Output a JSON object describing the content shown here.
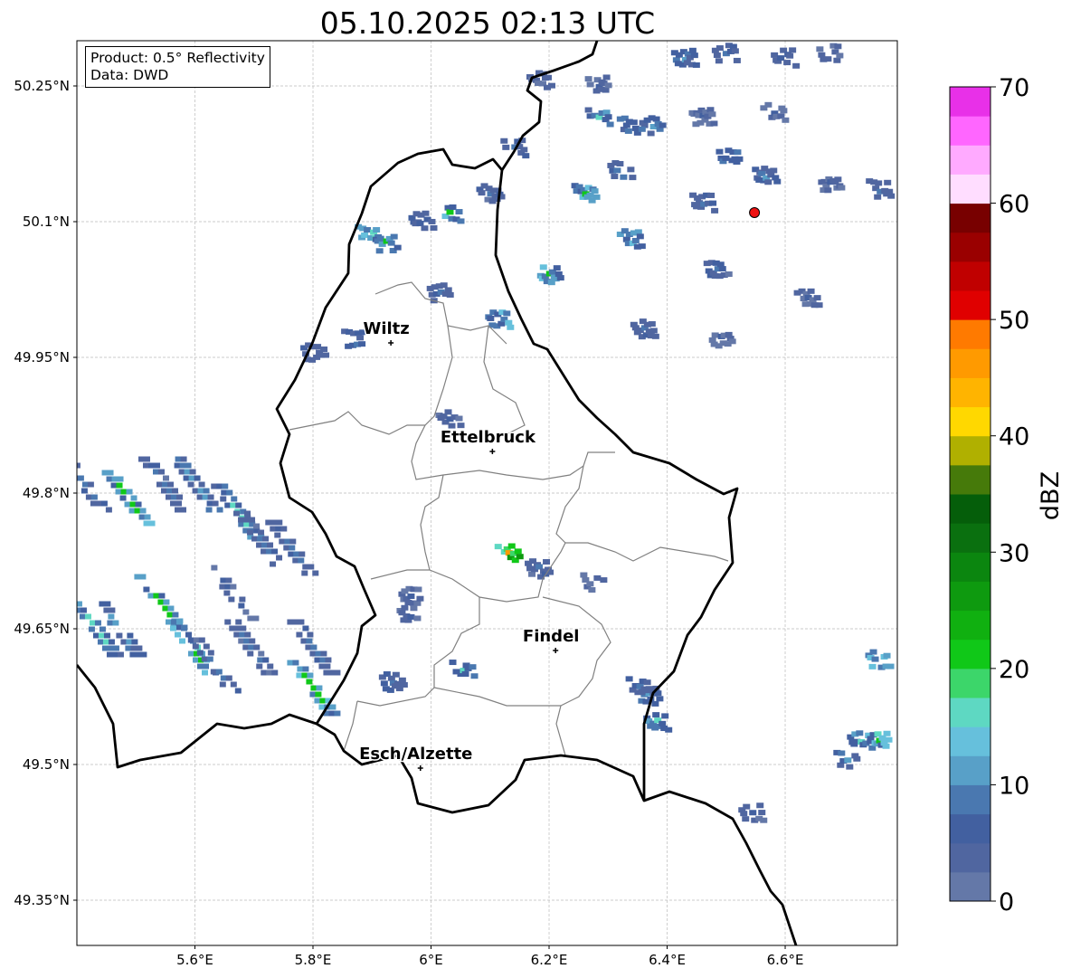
{
  "title": "05.10.2025 02:13 UTC",
  "info_box": {
    "product": "Product: 0.5° Reflectivity",
    "data": "Data: DWD"
  },
  "map": {
    "lon_range": [
      5.4,
      6.79
    ],
    "lat_range": [
      49.3,
      50.3
    ],
    "x_ticks": [
      {
        "value": 5.6,
        "label": "5.6°E"
      },
      {
        "value": 5.8,
        "label": "5.8°E"
      },
      {
        "value": 6.0,
        "label": "6°E"
      },
      {
        "value": 6.2,
        "label": "6.2°E"
      },
      {
        "value": 6.4,
        "label": "6.4°E"
      },
      {
        "value": 6.6,
        "label": "6.6°E"
      }
    ],
    "y_ticks": [
      {
        "value": 50.25,
        "label": "50.25°N"
      },
      {
        "value": 50.1,
        "label": "50.1°N"
      },
      {
        "value": 49.95,
        "label": "49.95°N"
      },
      {
        "value": 49.8,
        "label": "49.8°N"
      },
      {
        "value": 49.65,
        "label": "49.65°N"
      },
      {
        "value": 49.5,
        "label": "49.5°N"
      },
      {
        "value": 49.35,
        "label": "49.35°N"
      }
    ],
    "cities": [
      {
        "name": "Wiltz",
        "lon": 5.932,
        "lat": 49.966
      },
      {
        "name": "Ettelbruck",
        "lon": 6.104,
        "lat": 49.846
      },
      {
        "name": "Findel",
        "lon": 6.211,
        "lat": 49.626
      },
      {
        "name": "Esch/Alzette",
        "lon": 5.982,
        "lat": 49.496
      }
    ],
    "radar_site": {
      "lon": 6.548,
      "lat": 50.11,
      "color": "#ee1111"
    }
  },
  "colorbar": {
    "label": "dBZ",
    "min": 0,
    "max": 70,
    "ticks": [
      "0",
      "10",
      "20",
      "30",
      "40",
      "50",
      "60",
      "70"
    ],
    "colors": [
      "#6478a8",
      "#5066a0",
      "#4260a0",
      "#4a78b0",
      "#58a0c8",
      "#66c0dc",
      "#5ed8c2",
      "#3cd66a",
      "#10c818",
      "#10b010",
      "#0e9a0f",
      "#0b860f",
      "#0a700f",
      "#055e0a",
      "#467a0a",
      "#b0b000",
      "#ffd800",
      "#ffb400",
      "#ff9a00",
      "#ff7a00",
      "#e00000",
      "#c00000",
      "#9a0000",
      "#780000",
      "#ffddff",
      "#ffaaff",
      "#ff66ff",
      "#e830e8"
    ]
  },
  "echoes": [
    {
      "lon": 5.899,
      "lat": 50.086,
      "dbz": 22
    },
    {
      "lon": 5.929,
      "lat": 50.076,
      "dbz": 20
    },
    {
      "lon": 5.99,
      "lat": 50.101,
      "dbz": 8
    },
    {
      "lon": 6.036,
      "lat": 50.108,
      "dbz": 20
    },
    {
      "lon": 6.105,
      "lat": 50.131,
      "dbz": 8
    },
    {
      "lon": 6.021,
      "lat": 50.021,
      "dbz": 8
    },
    {
      "lon": 6.12,
      "lat": 49.991,
      "dbz": 20
    },
    {
      "lon": 5.876,
      "lat": 49.971,
      "dbz": 12
    },
    {
      "lon": 5.807,
      "lat": 49.956,
      "dbz": 8
    },
    {
      "lon": 6.036,
      "lat": 49.881,
      "dbz": 5
    },
    {
      "lon": 6.136,
      "lat": 49.734,
      "dbz": 45
    },
    {
      "lon": 6.187,
      "lat": 49.716,
      "dbz": 8
    },
    {
      "lon": 6.281,
      "lat": 49.701,
      "dbz": 5
    },
    {
      "lon": 5.97,
      "lat": 49.686,
      "dbz": 5
    },
    {
      "lon": 5.97,
      "lat": 49.666,
      "dbz": 5
    },
    {
      "lon": 6.059,
      "lat": 49.606,
      "dbz": 15
    },
    {
      "lon": 5.94,
      "lat": 49.591,
      "dbz": 8
    },
    {
      "lon": 5.419,
      "lat": 49.806,
      "dbz": 8
    },
    {
      "lon": 5.492,
      "lat": 49.791,
      "dbz": 20
    },
    {
      "lon": 5.554,
      "lat": 49.806,
      "dbz": 8
    },
    {
      "lon": 5.607,
      "lat": 49.806,
      "dbz": 12
    },
    {
      "lon": 5.677,
      "lat": 49.776,
      "dbz": 15
    },
    {
      "lon": 5.715,
      "lat": 49.746,
      "dbz": 8
    },
    {
      "lon": 5.769,
      "lat": 49.736,
      "dbz": 8
    },
    {
      "lon": 5.439,
      "lat": 49.646,
      "dbz": 15
    },
    {
      "lon": 5.478,
      "lat": 49.646,
      "dbz": 12
    },
    {
      "lon": 5.547,
      "lat": 49.676,
      "dbz": 20
    },
    {
      "lon": 5.6,
      "lat": 49.626,
      "dbz": 22
    },
    {
      "lon": 5.638,
      "lat": 49.606,
      "dbz": 8
    },
    {
      "lon": 5.668,
      "lat": 49.686,
      "dbz": 5
    },
    {
      "lon": 5.7,
      "lat": 49.626,
      "dbz": 8
    },
    {
      "lon": 5.806,
      "lat": 49.581,
      "dbz": 22
    },
    {
      "lon": 5.806,
      "lat": 49.626,
      "dbz": 8
    },
    {
      "lon": 6.373,
      "lat": 49.576,
      "dbz": 12
    },
    {
      "lon": 6.388,
      "lat": 49.546,
      "dbz": 15
    },
    {
      "lon": 6.358,
      "lat": 49.586,
      "dbz": 8
    },
    {
      "lon": 6.549,
      "lat": 49.446,
      "dbz": 5
    },
    {
      "lon": 6.733,
      "lat": 49.526,
      "dbz": 15
    },
    {
      "lon": 6.764,
      "lat": 49.526,
      "dbz": 22
    },
    {
      "lon": 6.764,
      "lat": 49.616,
      "dbz": 22
    },
    {
      "lon": 6.71,
      "lat": 49.506,
      "dbz": 12
    },
    {
      "lon": 6.205,
      "lat": 50.041,
      "dbz": 20
    },
    {
      "lon": 6.343,
      "lat": 50.081,
      "dbz": 20
    },
    {
      "lon": 6.266,
      "lat": 50.131,
      "dbz": 20
    },
    {
      "lon": 6.327,
      "lat": 50.156,
      "dbz": 12
    },
    {
      "lon": 6.381,
      "lat": 50.206,
      "dbz": 12
    },
    {
      "lon": 6.289,
      "lat": 50.216,
      "dbz": 15
    },
    {
      "lon": 6.343,
      "lat": 50.206,
      "dbz": 15
    },
    {
      "lon": 6.435,
      "lat": 50.281,
      "dbz": 12
    },
    {
      "lon": 6.504,
      "lat": 50.286,
      "dbz": 8
    },
    {
      "lon": 6.604,
      "lat": 50.281,
      "dbz": 8
    },
    {
      "lon": 6.681,
      "lat": 50.286,
      "dbz": 5
    },
    {
      "lon": 6.511,
      "lat": 50.171,
      "dbz": 12
    },
    {
      "lon": 6.572,
      "lat": 50.151,
      "dbz": 12
    },
    {
      "lon": 6.466,
      "lat": 50.121,
      "dbz": 8
    },
    {
      "lon": 6.681,
      "lat": 50.141,
      "dbz": 5
    },
    {
      "lon": 6.765,
      "lat": 50.136,
      "dbz": 8
    },
    {
      "lon": 6.49,
      "lat": 50.046,
      "dbz": 8
    },
    {
      "lon": 6.643,
      "lat": 50.016,
      "dbz": 5
    },
    {
      "lon": 6.366,
      "lat": 49.981,
      "dbz": 8
    },
    {
      "lon": 6.496,
      "lat": 49.971,
      "dbz": 5
    },
    {
      "lon": 6.19,
      "lat": 50.256,
      "dbz": 5
    },
    {
      "lon": 6.289,
      "lat": 50.251,
      "dbz": 5
    },
    {
      "lon": 6.146,
      "lat": 50.181,
      "dbz": 8
    },
    {
      "lon": 6.465,
      "lat": 50.216,
      "dbz": 5
    },
    {
      "lon": 6.586,
      "lat": 50.221,
      "dbz": 5
    }
  ]
}
